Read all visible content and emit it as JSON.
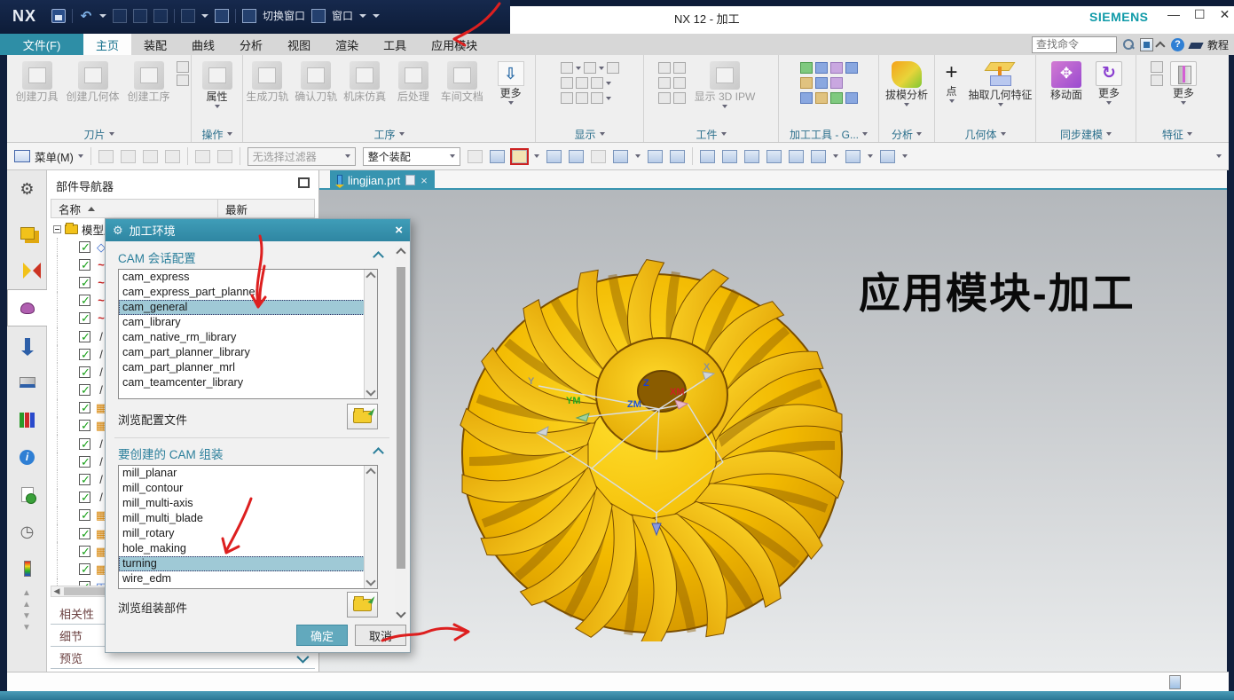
{
  "titlebar": {
    "app": "NX",
    "title": "NX 12 - 加工",
    "brand": "SIEMENS",
    "switch_window": "切换窗口",
    "window_menu": "窗口"
  },
  "search": {
    "placeholder": "查找命令",
    "tutorial": "教程"
  },
  "menu": {
    "file_tab": "文件(F)",
    "tabs": [
      {
        "label": "主页",
        "style": "active"
      },
      {
        "label": "装配"
      },
      {
        "label": "曲线"
      },
      {
        "label": "分析"
      },
      {
        "label": "视图"
      },
      {
        "label": "渲染"
      },
      {
        "label": "工具"
      },
      {
        "label": "应用模块"
      }
    ]
  },
  "ribbon": {
    "blade_group": {
      "label": "刀片",
      "create_tool": "创建刀具",
      "create_geometry": "创建几何体",
      "create_operation": "创建工序"
    },
    "operation_group": {
      "label": "操作",
      "properties": "属性"
    },
    "process_group": {
      "label": "工序",
      "generate": "生成刀轨",
      "verify": "确认刀轨",
      "simulate": "机床仿真",
      "postprocess": "后处理",
      "shop_doc": "车间文档",
      "more": "更多"
    },
    "display_group": {
      "label": "显示"
    },
    "workpiece_group": {
      "label": "工件",
      "show_ipw": "显示 3D IPW"
    },
    "tools_group": {
      "label": "加工工具 - G..."
    },
    "analysis_group": {
      "label": "分析",
      "draft": "拔模分析"
    },
    "geometry_group": {
      "label": "几何体",
      "point": "点",
      "extract": "抽取几何特征"
    },
    "sync_group": {
      "label": "同步建模",
      "move_face": "移动面",
      "more": "更多"
    },
    "feature_group": {
      "label": "特征",
      "more": "更多"
    }
  },
  "toolbar": {
    "menu": "菜单(M)",
    "filter": "无选择过滤器",
    "scope": "整个装配"
  },
  "navigator": {
    "title": "部件导航器",
    "col_name": "名称",
    "col_latest": "最新",
    "root": "模型历史",
    "tree_rows": [
      "datum",
      "spline",
      "spline",
      "spline",
      "spline",
      "line",
      "line",
      "line",
      "line",
      "mesh",
      "mesh",
      "line",
      "line",
      "line",
      "line",
      "mesh",
      "mesh",
      "mesh",
      "mesh",
      "revolve"
    ],
    "sections": [
      {
        "label": "相关性"
      },
      {
        "label": "细节"
      },
      {
        "label": "预览",
        "style": "with-chevron"
      }
    ]
  },
  "part_tab": {
    "label": "lingjian.prt"
  },
  "dialog": {
    "title": "加工环境",
    "session_label": "CAM 会话配置",
    "session_items": [
      {
        "label": "cam_express"
      },
      {
        "label": "cam_express_part_planner"
      },
      {
        "label": "cam_general",
        "selected": true
      },
      {
        "label": "cam_library"
      },
      {
        "label": "cam_native_rm_library"
      },
      {
        "label": "cam_part_planner_library"
      },
      {
        "label": "cam_part_planner_mrl"
      },
      {
        "label": "cam_teamcenter_library"
      }
    ],
    "browse_config": "浏览配置文件",
    "assembly_label": "要创建的 CAM 组装",
    "assembly_items": [
      {
        "label": "mill_planar"
      },
      {
        "label": "mill_contour"
      },
      {
        "label": "mill_multi-axis"
      },
      {
        "label": "mill_multi_blade"
      },
      {
        "label": "mill_rotary"
      },
      {
        "label": "hole_making"
      },
      {
        "label": "turning",
        "selected": true
      },
      {
        "label": "wire_edm"
      }
    ],
    "browse_assembly": "浏览组装部件",
    "ok": "确定",
    "cancel": "取消"
  },
  "viewport": {
    "note": "应用模块-加工",
    "axes": {
      "y": "Y",
      "ym": "YM",
      "z": "Z",
      "zm": "ZM",
      "xm": "XM",
      "x": "X"
    }
  },
  "colors": {
    "accent_teal": "#3794b0",
    "selection_teal": "#9fc9d6",
    "gold": "#f5c400",
    "annotation_red": "#dd1f1f",
    "navy": "#101f3c"
  }
}
